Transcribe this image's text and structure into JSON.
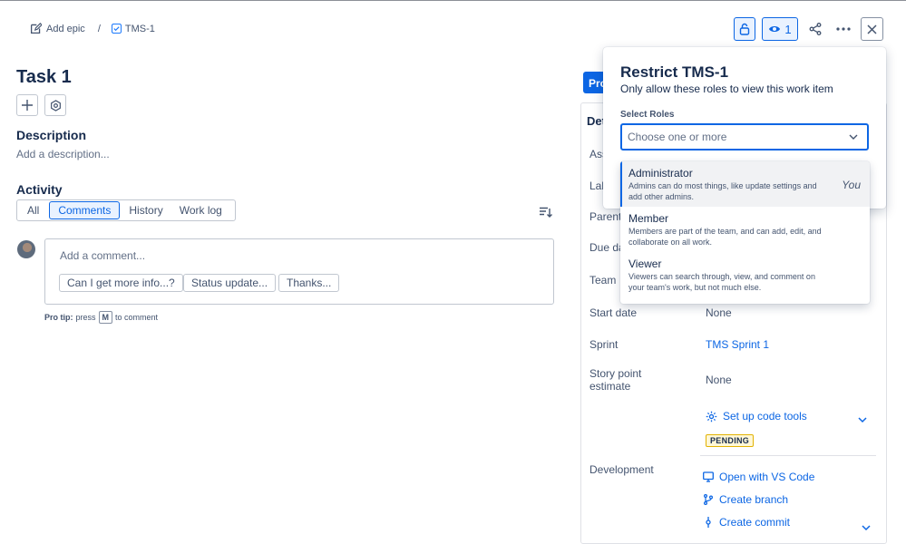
{
  "breadcrumb": {
    "add_epic": "Add epic",
    "separator": "/",
    "issue_key": "TMS-1"
  },
  "header": {
    "watchers_count": "1"
  },
  "issue": {
    "title": "Task 1"
  },
  "description": {
    "heading": "Description",
    "placeholder": "Add a description..."
  },
  "activity": {
    "heading": "Activity",
    "tabs": [
      {
        "label": "All"
      },
      {
        "label": "Comments",
        "active": true
      },
      {
        "label": "History"
      },
      {
        "label": "Work log"
      }
    ]
  },
  "comment": {
    "placeholder": "Add a comment...",
    "quick_replies": [
      "Can I get more info...?",
      "Status update...",
      "Thanks..."
    ],
    "pro_tip_prefix": "Pro tip:",
    "pro_tip_press": "press",
    "pro_tip_key": "M",
    "pro_tip_suffix": "to comment"
  },
  "status_button": {
    "label": "Pro"
  },
  "details": {
    "heading": "Det",
    "fields": {
      "assignee": "Ass",
      "labels": "Lab",
      "parent": "Parent",
      "due_date": "Due da",
      "team": "Team",
      "start_date": "Start date",
      "start_date_value": "None",
      "sprint": "Sprint",
      "sprint_value": "TMS Sprint 1",
      "story_points_line1": "Story point",
      "story_points_line2": "estimate",
      "story_points_value": "None",
      "development": "Development"
    },
    "code_tools": {
      "label": "Set up code tools",
      "badge": "PENDING"
    },
    "dev_links": [
      "Open with VS Code",
      "Create branch",
      "Create commit"
    ]
  },
  "restrict_popover": {
    "title": "Restrict TMS-1",
    "subtitle": "Only allow these roles to view this work item",
    "select_label": "Select Roles",
    "select_placeholder": "Choose one or more",
    "options": [
      {
        "name": "Administrator",
        "description": "Admins can do most things, like update settings and add other admins.",
        "tag": "You"
      },
      {
        "name": "Member",
        "description": "Members are part of the team, and can add, edit, and collaborate on all work."
      },
      {
        "name": "Viewer",
        "description": "Viewers can search through, view, and comment on your team's work, but not much else."
      }
    ]
  },
  "colors": {
    "accent": "#0c66e4",
    "text": "#172b4d",
    "badge_bg": "#fff7d6"
  }
}
